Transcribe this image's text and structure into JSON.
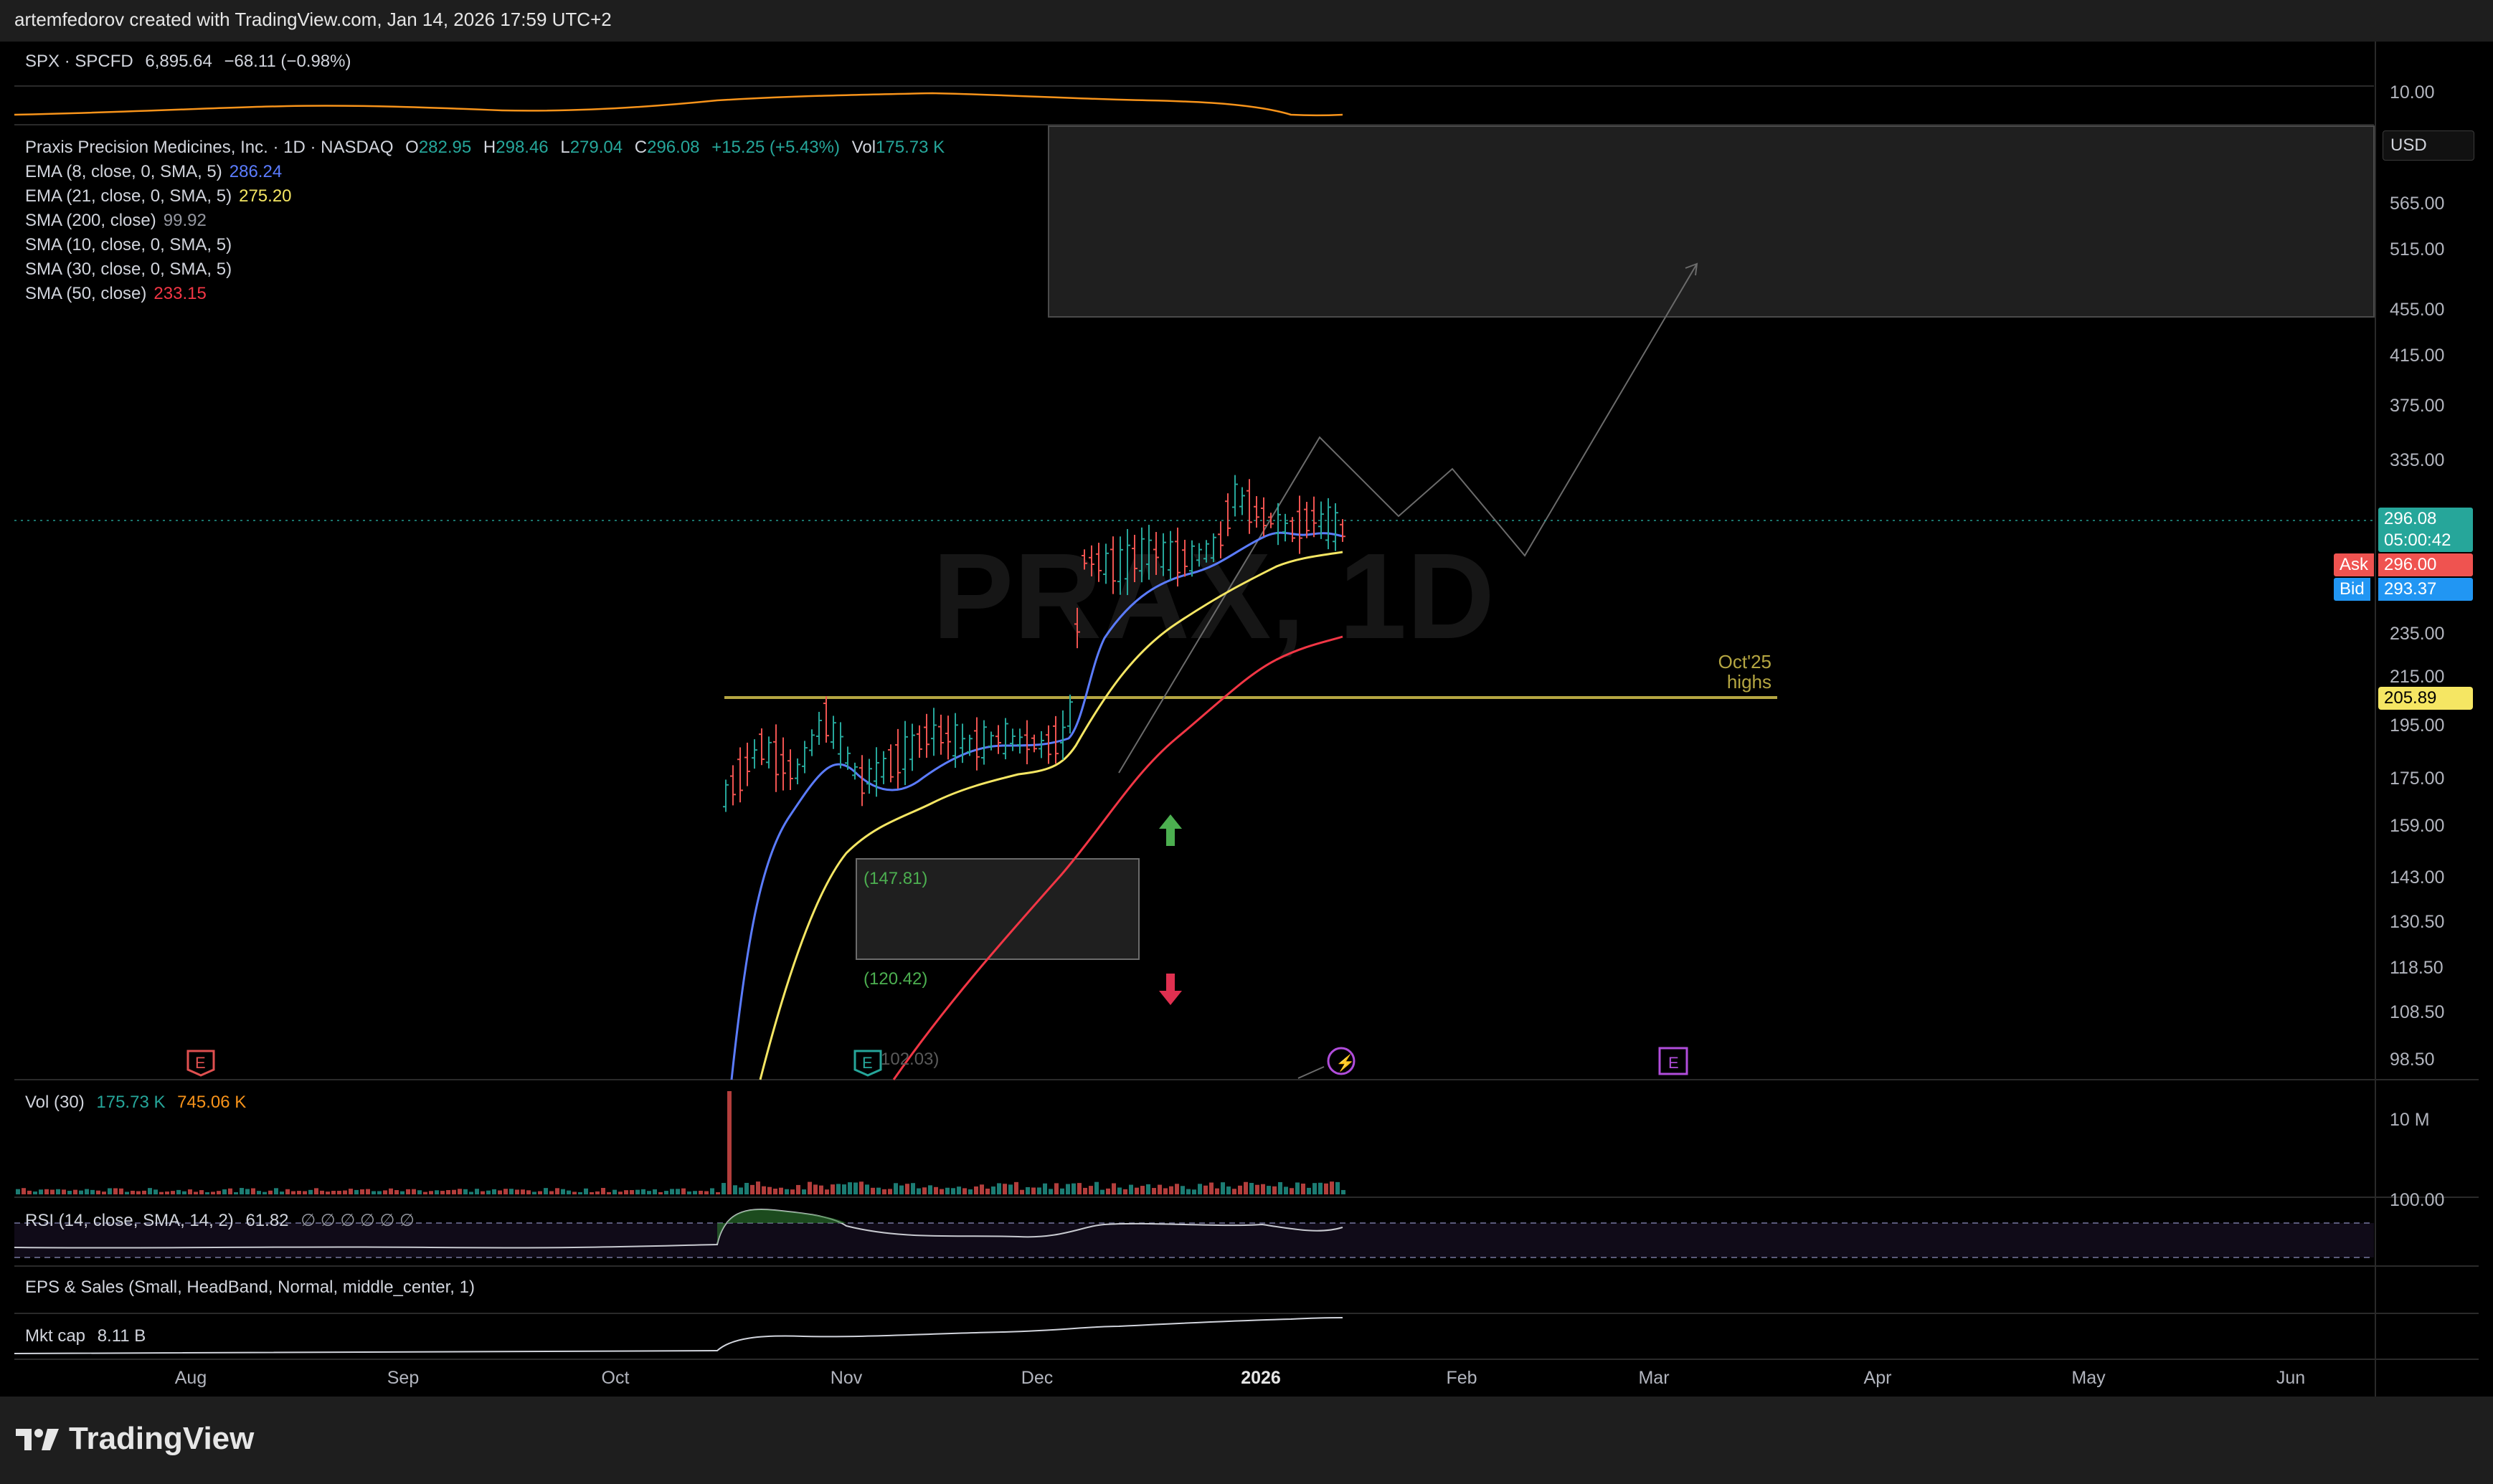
{
  "header": {
    "credit": "artemfedorov created with TradingView.com, Jan 14, 2026 17:59 UTC+2"
  },
  "compare": {
    "symbol": "SPX · SPCFD",
    "price": "6,895.64",
    "change": "−68.11 (−0.98%)",
    "scale_label": "10.00"
  },
  "main": {
    "title": "Praxis Precision Medicines, Inc. · 1D · NASDAQ",
    "o_label": "O",
    "o": "282.95",
    "h_label": "H",
    "h": "298.46",
    "l_label": "L",
    "l": "279.04",
    "c_label": "C",
    "c": "296.08",
    "chg": "+15.25 (+5.43%)",
    "vol_label": "Vol",
    "vol": "175.73 K",
    "watermark": "PRAX, 1D",
    "indicators": [
      {
        "name": "EMA (8, close, 0, SMA, 5)",
        "value": "286.24",
        "color": "#5b7cff"
      },
      {
        "name": "EMA (21, close, 0, SMA, 5)",
        "value": "275.20",
        "color": "#f5e663"
      },
      {
        "name": "SMA (200, close)",
        "value": "99.92",
        "color": "#9598a1"
      },
      {
        "name": "SMA (10, close, 0, SMA, 5)",
        "value": "",
        "color": "#9598a1"
      },
      {
        "name": "SMA (30, close, 0, SMA, 5)",
        "value": "",
        "color": "#9598a1"
      },
      {
        "name": "SMA (50, close)",
        "value": "233.15",
        "color": "#f23645"
      }
    ],
    "annotations": {
      "level_note_line1": "Oct'25",
      "level_note_line2": "highs",
      "box_top": "(147.81)",
      "box_bottom": "(120.42)",
      "partial_label": "102.03)"
    }
  },
  "price_scale": {
    "currency": "USD",
    "ticks": [
      "565.00",
      "515.00",
      "455.00",
      "415.00",
      "375.00",
      "335.00",
      "235.00",
      "215.00",
      "195.00",
      "175.00",
      "159.00",
      "143.00",
      "130.50",
      "118.50",
      "108.50",
      "98.50"
    ],
    "last_price": "296.08",
    "countdown": "05:00:42",
    "ask_label": "Ask",
    "ask": "296.00",
    "bid_label": "Bid",
    "bid": "293.37",
    "level_tag": "205.89"
  },
  "volume": {
    "label": "Vol (30)",
    "v1": "175.73 K",
    "v2": "745.06 K",
    "scale_top": "10 M",
    "scale_bottom": "100.00"
  },
  "rsi": {
    "label": "RSI (14, close, SMA, 14, 2)",
    "value": "61.82",
    "extra": "∅ ∅ ∅ ∅ ∅ ∅"
  },
  "eps": {
    "label": "EPS & Sales (Small, HeadBand, Normal, middle_center, 1)"
  },
  "mktcap": {
    "label": "Mkt cap",
    "value": "8.11 B"
  },
  "time_axis": [
    "Aug",
    "Sep",
    "Oct",
    "Nov",
    "Dec",
    "2026",
    "Feb",
    "Mar",
    "Apr",
    "May",
    "Jun"
  ],
  "footer": {
    "brand": "TradingView"
  },
  "colors": {
    "up": "#26a69a",
    "down": "#ef5350",
    "ema8": "#5b7cff",
    "ema21": "#f5e663",
    "sma50": "#f23645",
    "level": "#b5a642",
    "spx": "#f7931a",
    "rsi": "#b2b5be",
    "mktcap": "#d1d4dc"
  },
  "icons": [
    "earnings-icon",
    "dividend-icon",
    "arrow-up-icon",
    "arrow-down-icon"
  ]
}
